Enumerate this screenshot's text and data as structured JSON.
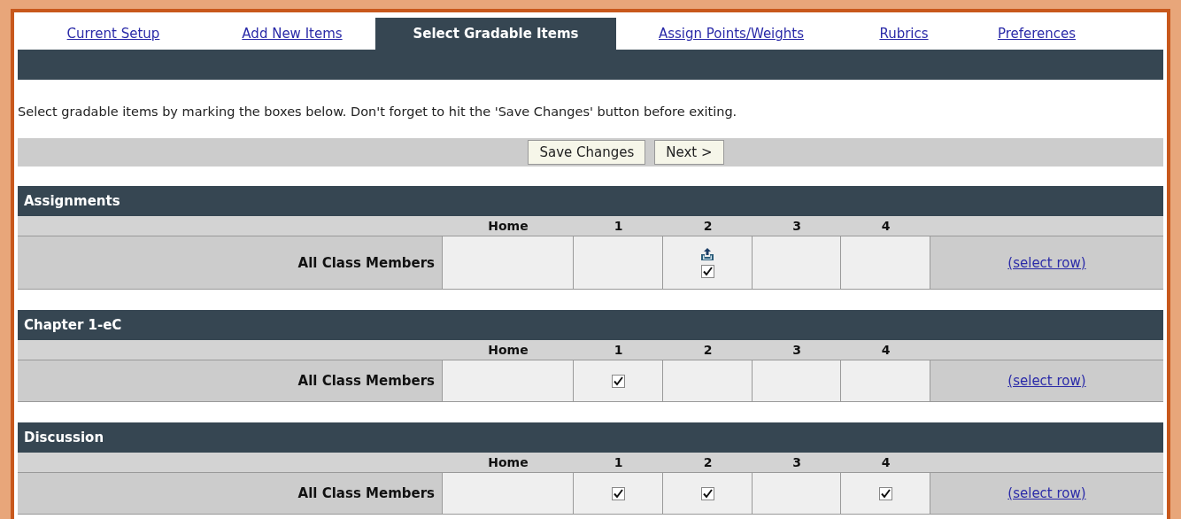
{
  "tabs": [
    {
      "label": "Current Setup",
      "selected": false
    },
    {
      "label": "Add New Items",
      "selected": false
    },
    {
      "label": "Select Gradable Items",
      "selected": true
    },
    {
      "label": "Assign Points/Weights",
      "selected": false
    },
    {
      "label": "Rubrics",
      "selected": false
    },
    {
      "label": "Preferences",
      "selected": false
    }
  ],
  "instruction": "Select gradable items by marking the boxes below. Don't forget to hit the 'Save Changes' button before exiting.",
  "buttons": [
    "Save Changes",
    "Next >"
  ],
  "sections": [
    {
      "title": "Assignments",
      "columns": [
        "Home",
        "1",
        "2",
        "3",
        "4"
      ],
      "row_label": "All Class Members",
      "link": "(select row)",
      "cells": [
        {
          "kind": "empty"
        },
        {
          "kind": "empty"
        },
        {
          "kind": "checkbox-with-icon",
          "checked": true
        },
        {
          "kind": "empty"
        },
        {
          "kind": "empty"
        }
      ]
    },
    {
      "title": "Chapter 1-eC",
      "columns": [
        "Home",
        "1",
        "2",
        "3",
        "4"
      ],
      "row_label": "All Class Members",
      "link": "(select row)",
      "cells": [
        {
          "kind": "empty"
        },
        {
          "kind": "checkbox",
          "checked": true
        },
        {
          "kind": "empty"
        },
        {
          "kind": "empty"
        },
        {
          "kind": "empty"
        }
      ]
    },
    {
      "title": "Discussion",
      "columns": [
        "Home",
        "1",
        "2",
        "3",
        "4"
      ],
      "row_label": "All Class Members",
      "link": "(select row)",
      "cells": [
        {
          "kind": "empty"
        },
        {
          "kind": "checkbox",
          "checked": true
        },
        {
          "kind": "checkbox",
          "checked": true
        },
        {
          "kind": "empty"
        },
        {
          "kind": "checkbox",
          "checked": true
        }
      ]
    }
  ]
}
